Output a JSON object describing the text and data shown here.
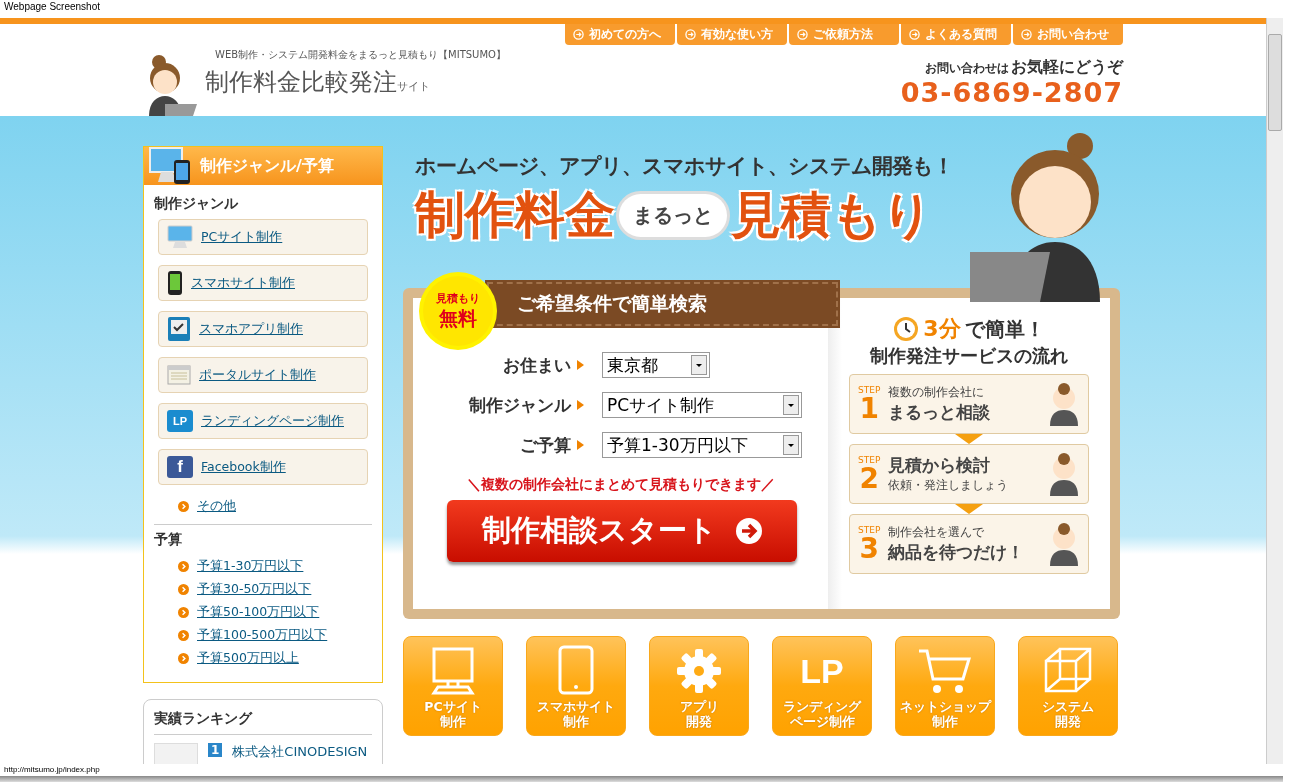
{
  "window": {
    "title": "Webpage Screenshot",
    "status_url": "http://mitsumo.jp/index.php"
  },
  "header": {
    "tagline": "WEB制作・システム開発料金をまるっと見積もり【MITSUMO】",
    "site_title": "制作料金比較発注",
    "site_title_suffix": "サイト",
    "nav": [
      "初めての方へ",
      "有効な使い方",
      "ご依頼方法",
      "よくある質問",
      "お問い合わせ"
    ],
    "contact_lead": "お問い合わせは",
    "contact_emphasis": "お気軽にどうぞ",
    "phone": "03-6869-2807"
  },
  "sidebar": {
    "title": "制作ジャンル/予算",
    "genre_heading": "制作ジャンル",
    "genres": [
      {
        "label": "PCサイト制作",
        "kind": "monitor"
      },
      {
        "label": "スマホサイト制作",
        "kind": "phone"
      },
      {
        "label": "スマホアプリ制作",
        "kind": "app"
      },
      {
        "label": "ポータルサイト制作",
        "kind": "portal"
      },
      {
        "label": "ランディングページ制作",
        "kind": "lp",
        "icon_text": "LP"
      },
      {
        "label": "Facebook制作",
        "kind": "facebook",
        "icon_text": "f"
      }
    ],
    "other_link": "その他",
    "budget_heading": "予算",
    "budgets": [
      "予算1-30万円以下",
      "予算30-50万円以下",
      "予算50-100万円以下",
      "予算100-500万円以下",
      "予算500万円以上"
    ]
  },
  "ranking": {
    "title": "実績ランキング",
    "items": [
      {
        "rank": "1",
        "name": "株式会社CINODESIGN"
      }
    ]
  },
  "hero": {
    "subtitle": "ホームページ、アプリ、スマホサイト、システム開発も！",
    "title_left": "制作料金",
    "title_bubble": "まるっと",
    "title_right": "見積もり"
  },
  "search": {
    "badge_top": "見積もり",
    "badge_bottom": "無料",
    "banner": "ご希望条件で簡単検索",
    "fields": [
      {
        "label": "お住まい",
        "value": "東京都"
      },
      {
        "label": "制作ジャンル",
        "value": "PCサイト制作"
      },
      {
        "label": "ご予算",
        "value": "予算1-30万円以下"
      }
    ],
    "note": "＼複数の制作会社にまとめて見積もりできます／",
    "submit": "制作相談スタート"
  },
  "flow": {
    "highlight": "3分",
    "title_rest": "で簡単！",
    "subtitle": "制作発注サービスの流れ",
    "steps": [
      {
        "label": "STEP",
        "number": "1",
        "lines": [
          {
            "kind": "small",
            "text": "複数の制作会社に"
          },
          {
            "kind": "large",
            "text": "まるっと相談"
          }
        ]
      },
      {
        "label": "STEP",
        "number": "2",
        "lines": [
          {
            "kind": "large",
            "text": "見積から検討"
          },
          {
            "kind": "small",
            "text": "依頼・発注しましょう"
          }
        ]
      },
      {
        "label": "STEP",
        "number": "3",
        "lines": [
          {
            "kind": "small",
            "text": "制作会社を選んで"
          },
          {
            "kind": "large",
            "text": "納品を待つだけ！"
          }
        ]
      }
    ]
  },
  "categories": [
    {
      "kind": "monitor",
      "lines": [
        "PCサイト",
        "制作"
      ]
    },
    {
      "kind": "tablet",
      "lines": [
        "スマホサイト",
        "制作"
      ]
    },
    {
      "kind": "gear",
      "lines": [
        "アプリ",
        "開発"
      ]
    },
    {
      "kind": "lp",
      "icon_text": "LP",
      "lines": [
        "ランディング",
        "ページ制作"
      ]
    },
    {
      "kind": "cart",
      "lines": [
        "ネットショップ",
        "制作"
      ]
    },
    {
      "kind": "cube",
      "lines": [
        "システム",
        "開発"
      ]
    }
  ]
}
